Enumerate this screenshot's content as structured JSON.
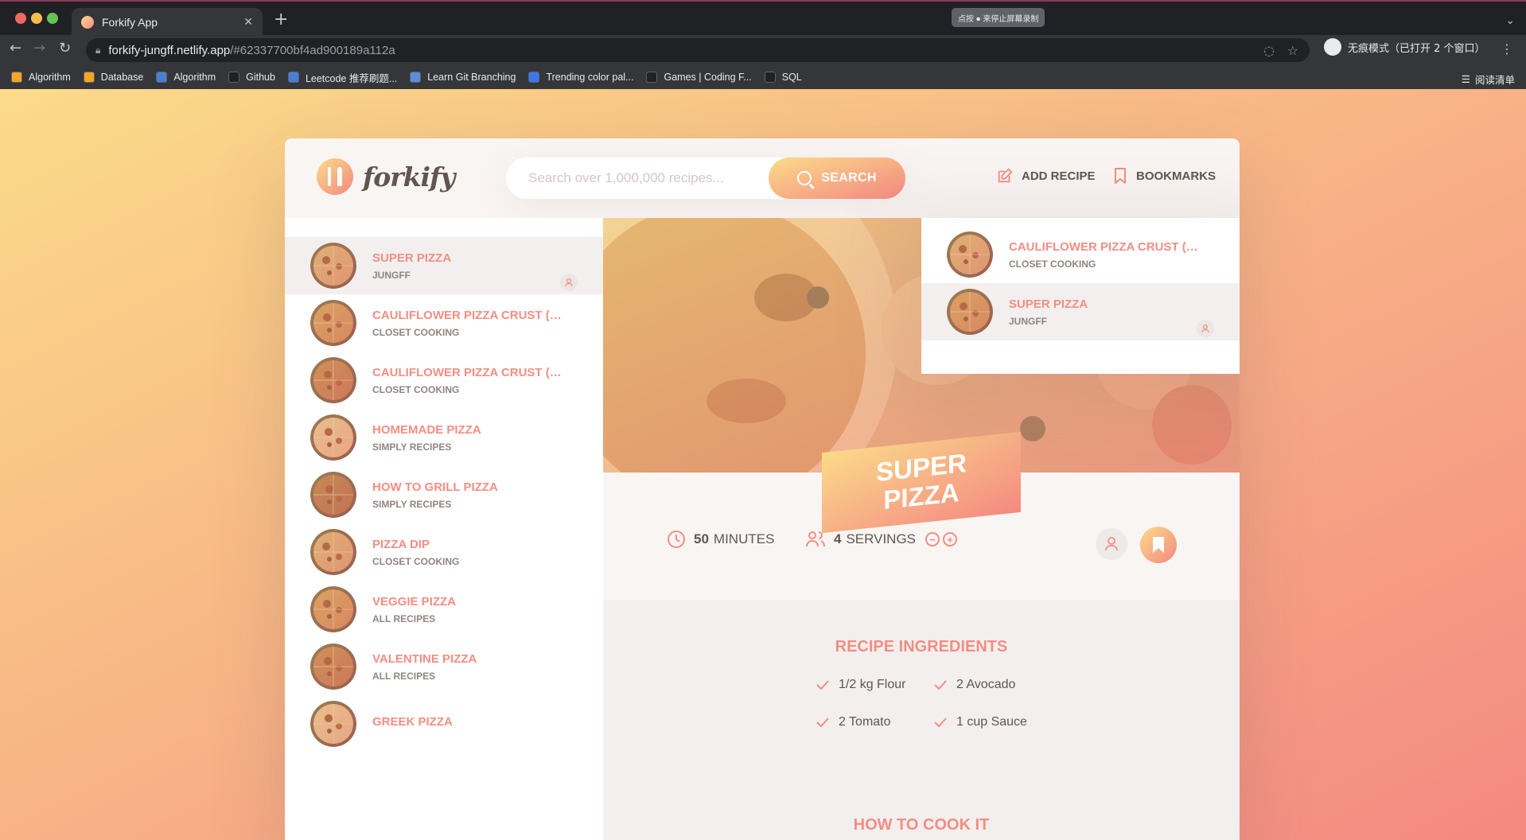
{
  "browser": {
    "tab_title": "Forkify App",
    "url_host": "forkify-jungff.netlify.app",
    "url_path": "/#62337700bf4ad900189a112a",
    "recording_hint": "点按 ⏺ 来停止屏幕录制",
    "incognito_label": "无痕模式（已打开 2 个窗口）",
    "reading_list": "阅读清单",
    "bookmarks": [
      {
        "label": "Algorithm",
        "color": "#f5a623"
      },
      {
        "label": "Database",
        "color": "#f5a623"
      },
      {
        "label": "Algorithm",
        "color": "#4a7fd6"
      },
      {
        "label": "Github",
        "color": "#202124"
      },
      {
        "label": "Leetcode 推荐刷题...",
        "color": "#4a7fd6"
      },
      {
        "label": "Learn Git Branching",
        "color": "#5b8dd9"
      },
      {
        "label": "Trending color pal...",
        "color": "#3a78f2"
      },
      {
        "label": "Games | Coding F...",
        "color": "#202124"
      },
      {
        "label": "SQL",
        "color": "#202124"
      }
    ]
  },
  "header": {
    "logo_text": "forkify",
    "search_placeholder": "Search over 1,000,000 recipes...",
    "search_button": "SEARCH",
    "add_recipe": "ADD RECIPE",
    "bookmarks": "BOOKMARKS"
  },
  "results": [
    {
      "title": "SUPER PIZZA",
      "publisher": "JUNGFF",
      "active": true,
      "user": true
    },
    {
      "title": "CAULIFLOWER PIZZA CRUST (WIT...",
      "publisher": "CLOSET COOKING"
    },
    {
      "title": "CAULIFLOWER PIZZA CRUST (WIT...",
      "publisher": "CLOSET COOKING"
    },
    {
      "title": "HOMEMADE PIZZA",
      "publisher": "SIMPLY RECIPES"
    },
    {
      "title": "HOW TO GRILL PIZZA",
      "publisher": "SIMPLY RECIPES"
    },
    {
      "title": "PIZZA DIP",
      "publisher": "CLOSET COOKING"
    },
    {
      "title": "VEGGIE PIZZA",
      "publisher": "ALL RECIPES"
    },
    {
      "title": "VALENTINE PIZZA",
      "publisher": "ALL RECIPES"
    },
    {
      "title": "GREEK PIZZA",
      "publisher": ""
    }
  ],
  "bookmarks_panel": [
    {
      "title": "CAULIFLOWER PIZZA CRUST (WIT...",
      "publisher": "CLOSET COOKING"
    },
    {
      "title": "SUPER PIZZA",
      "publisher": "JUNGFF",
      "user": true
    }
  ],
  "recipe": {
    "title": "SUPER PIZZA",
    "minutes": "50",
    "minutes_label": "MINUTES",
    "servings": "4",
    "servings_label": "SERVINGS",
    "ingredients_heading": "RECIPE INGREDIENTS",
    "ingredients": [
      "1/2 kg Flour",
      "2 Avocado",
      "2 Tomato",
      "1 cup Sauce"
    ],
    "how_to_cook": "HOW TO COOK IT"
  },
  "colors": {
    "gradient_start": "#fbdb89",
    "gradient_end": "#f48982",
    "accent": "#f38e82",
    "text": "#615551"
  }
}
